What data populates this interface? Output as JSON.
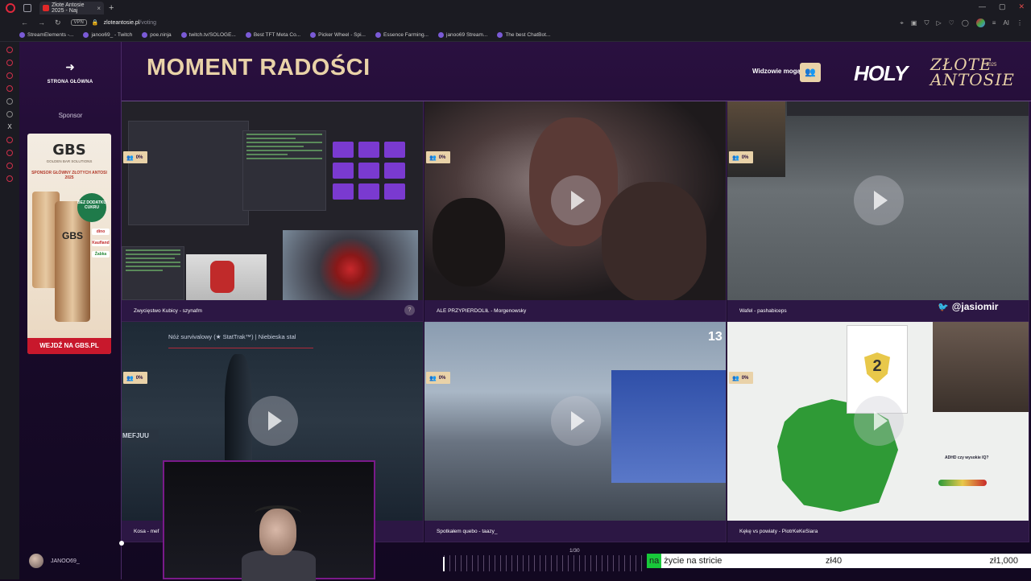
{
  "browser": {
    "tab_title": "Złote Antosie 2025 - Naj",
    "url_domain": "zloteantosie.pl",
    "url_path": "/voting",
    "vpn_label": "VPN",
    "bookmarks": [
      "StreamElements -...",
      "janoo69_ - Twitch",
      "poe.ninja",
      "twitch.tv/SOLOGE...",
      "Best TFT Meta Co...",
      "Picker Wheel - Spi...",
      "Essence Farming...",
      "janoo69 Stream...",
      "The best ChatBot..."
    ],
    "toolbar_right_label": "AI"
  },
  "sidebar": {
    "home_label": "STRONA GŁÓWNA",
    "sponsor_label": "Sponsor",
    "user_name": "JANOO69_"
  },
  "ad": {
    "brand": "GBS",
    "brand_sub": "GOLDEN BAR SOLUTIONS",
    "tagline": "SPONSOR GŁÓWNY ZŁOTYCH ANTOSI 2025",
    "badge": "BEZ DODATKU CUKRU",
    "retailers": [
      "dino",
      "Kaufland",
      "Żabka"
    ],
    "cta": "WEJDŹ NA GBS.PL"
  },
  "header": {
    "title": "MOMENT RADOŚCI",
    "viewers_label": "Widzowie mogą",
    "brand_holy": "HOLY",
    "brand_zlote": "ZŁOTE",
    "brand_year": "2025",
    "brand_antosie": "ANTOSIE"
  },
  "cards": [
    {
      "caption": "Zwycięstwo Kubicy - szynafm",
      "percent": "0%"
    },
    {
      "caption": "ALE PRZYPIERDOLIŁ - Morgenowsky",
      "percent": "0%"
    },
    {
      "caption": "Wafel - pashabiceps",
      "percent": "0%"
    },
    {
      "caption": "Kosa - mef",
      "percent": "0%",
      "overlay_title": "Nóż survivalowy (★ StatTrak™) | Niebieska stal",
      "overlay_tag": "MEFJUU"
    },
    {
      "caption": "Spotkałem quebo - taazy_",
      "percent": "0%",
      "platform_number": "13"
    },
    {
      "caption": "Kękę vs powiaty - PiotrKeKeSiara",
      "percent": "0%",
      "quiz_number": "2",
      "quiz_text": "ADHD czy wysokie IQ?"
    }
  ],
  "twitter_handle": "@jasiomir",
  "pagination": "1/30",
  "donation": {
    "highlight": "na",
    "message": "życie na stricie",
    "amount": "zł40",
    "goal": "zł1,000"
  },
  "colors": {
    "accent_gold": "#e9d2a8",
    "bg_purple": "#1a0b2b",
    "cta_red": "#c8182c",
    "donation_green": "#18c83a"
  }
}
